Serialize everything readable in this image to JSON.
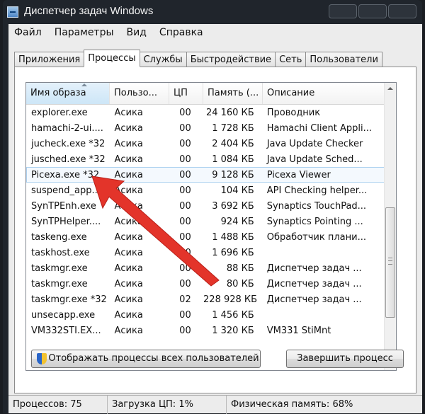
{
  "window": {
    "title": "Диспетчер задач Windows"
  },
  "menu": [
    "Файл",
    "Параметры",
    "Вид",
    "Справка"
  ],
  "tabs": [
    "Приложения",
    "Процессы",
    "Службы",
    "Быстродействие",
    "Сеть",
    "Пользователи"
  ],
  "active_tab": "Процессы",
  "columns": [
    "Имя образа",
    "Пользо...",
    "ЦП",
    "Память (...",
    "Описание"
  ],
  "rows": [
    {
      "name": "explorer.exe",
      "user": "Асика",
      "cpu": "00",
      "mem": "24 160 КБ",
      "desc": "Проводник"
    },
    {
      "name": "hamachi-2-ui....",
      "user": "Асика",
      "cpu": "00",
      "mem": "1 728 КБ",
      "desc": "Hamachi Client Appli..."
    },
    {
      "name": "jucheck.exe *32",
      "user": "Асика",
      "cpu": "00",
      "mem": "2 404 КБ",
      "desc": "Java Update Checker"
    },
    {
      "name": "jusched.exe *32",
      "user": "Асика",
      "cpu": "00",
      "mem": "1 084 КБ",
      "desc": "Java Update Sched..."
    },
    {
      "name": "Picexa.exe *32",
      "user": "Асика",
      "cpu": "00",
      "mem": "9 128 КБ",
      "desc": "Picexa Viewer"
    },
    {
      "name": "suspend_app...",
      "user": "Асика",
      "cpu": "00",
      "mem": "104 КБ",
      "desc": "API Checking helper..."
    },
    {
      "name": "SynTPEnh.exe",
      "user": "Асика",
      "cpu": "00",
      "mem": "3 692 КБ",
      "desc": "Synaptics TouchPad..."
    },
    {
      "name": "SynTPHelper....",
      "user": "Асика",
      "cpu": "00",
      "mem": "924 КБ",
      "desc": "Synaptics Pointing ..."
    },
    {
      "name": "taskeng.exe",
      "user": "Асика",
      "cpu": "00",
      "mem": "1 488 КБ",
      "desc": "Обработчик плани..."
    },
    {
      "name": "taskhost.exe",
      "user": "Асика",
      "cpu": "00",
      "mem": "1 696 КБ",
      "desc": ""
    },
    {
      "name": "taskmgr.exe",
      "user": "Асика",
      "cpu": "00",
      "mem": "88 КБ",
      "desc": "Диспетчер задач ..."
    },
    {
      "name": "taskmgr.exe",
      "user": "Асика",
      "cpu": "00",
      "mem": "80 КБ",
      "desc": "Диспетчер задач ..."
    },
    {
      "name": "taskmgr.exe *32",
      "user": "Асика",
      "cpu": "02",
      "mem": "228 928 КБ",
      "desc": "Диспетчер задач ..."
    },
    {
      "name": "unsecapp.exe",
      "user": "Асика",
      "cpu": "00",
      "mem": "1 456 КБ",
      "desc": ""
    },
    {
      "name": "VM332STI.EX...",
      "user": "Асика",
      "cpu": "00",
      "mem": "1 320 КБ",
      "desc": "VM331 StiMnt"
    }
  ],
  "selected_row": 4,
  "buttons": {
    "show_all": "Отображать процессы всех пользователей",
    "end_process": "Завершить процесс"
  },
  "status": {
    "processes": "Процессов: 75",
    "cpu": "Загрузка ЦП: 1%",
    "memory": "Физическая память: 68%"
  },
  "colors": {
    "arrow": "#e3342a",
    "selection_border": "#aed2f0",
    "title_bar": "#20252c"
  },
  "icons": [
    "app-icon",
    "shield-icon",
    "sort-ascending-icon",
    "scroll-up-icon",
    "scroll-down-icon"
  ]
}
